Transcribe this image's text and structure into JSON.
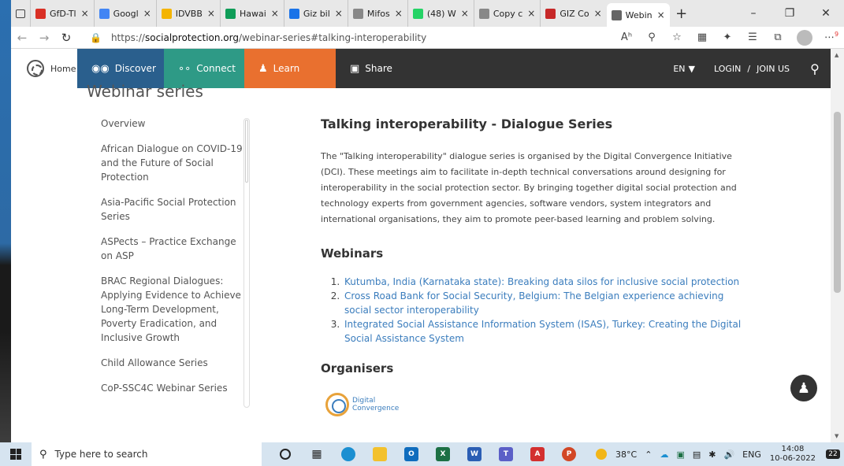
{
  "browser": {
    "tabs": [
      {
        "label": "GfD-Tl",
        "icon": "gmail-icon",
        "color": "#d93025"
      },
      {
        "label": "Googl",
        "icon": "google-forms-icon",
        "color": "#4285f4"
      },
      {
        "label": "IDVBB",
        "icon": "document-icon",
        "color": "#f4b400"
      },
      {
        "label": "Hawai",
        "icon": "sheets-icon",
        "color": "#0f9d58"
      },
      {
        "label": "Giz bil",
        "icon": "drive-icon",
        "color": "#1a73e8"
      },
      {
        "label": "Mifos",
        "icon": "page-icon",
        "color": "#888888"
      },
      {
        "label": "(48) W",
        "icon": "whatsapp-icon",
        "color": "#25d366"
      },
      {
        "label": "Copy c",
        "icon": "page-icon",
        "color": "#888888"
      },
      {
        "label": "GIZ Co",
        "icon": "giz-icon",
        "color": "#c62828"
      },
      {
        "label": "Webin",
        "icon": "socialprotection-icon",
        "color": "#666666"
      }
    ],
    "url_prefix": "https://",
    "url_host": "socialprotection.org",
    "url_path": "/webinar-series#talking-interoperability",
    "zoom_label": "Aʰ",
    "notif_count": "9"
  },
  "nav": {
    "home": "Home",
    "discover": "Discover",
    "connect": "Connect",
    "learn": "Learn",
    "share": "Share",
    "lang": "EN",
    "login": "LOGIN",
    "separator": "/",
    "join": "JOIN US"
  },
  "page": {
    "section_title": "Webinar series",
    "sidebar": [
      "Overview",
      "African Dialogue on COVID-19 and the Future of Social Protection",
      "Asia-Pacific Social Protection Series",
      "ASPects – Practice Exchange on ASP",
      "BRAC Regional Dialogues: Applying Evidence to Achieve Long-Term Development, Poverty Eradication, and Inclusive Growth",
      "Child Allowance Series",
      "CoP-SSC4C Webinar Series"
    ],
    "main_title": "Talking interoperability - Dialogue Series",
    "intro": "The \"Talking interoperability\" dialogue series is organised by the Digital Convergence Initiative (DCI). These meetings aim to facilitate in-depth technical conversations around designing for interoperability in the social protection sector. By bringing together digital social protection and technology experts from government agencies, software vendors, system integrators and international organisations, they aim to promote peer-based learning and problem solving.",
    "webinars_heading": "Webinars",
    "webinars": [
      "Kutumba, India (Karnataka state): Breaking data silos for inclusive social protection",
      "Cross Road Bank for Social Security, Belgium: The Belgian experience achieving social sector interoperability",
      "Integrated Social Assistance Information System (ISAS), Turkey: Creating the Digital Social Assistance System"
    ],
    "organisers_heading": "Organisers",
    "organiser_logo_line1": "Digital",
    "organiser_logo_line2": "Convergence"
  },
  "taskbar": {
    "search_placeholder": "Type here to search",
    "temperature": "38°C",
    "language": "ENG",
    "time": "14:08",
    "date": "10-06-2022",
    "notifications": "22"
  }
}
